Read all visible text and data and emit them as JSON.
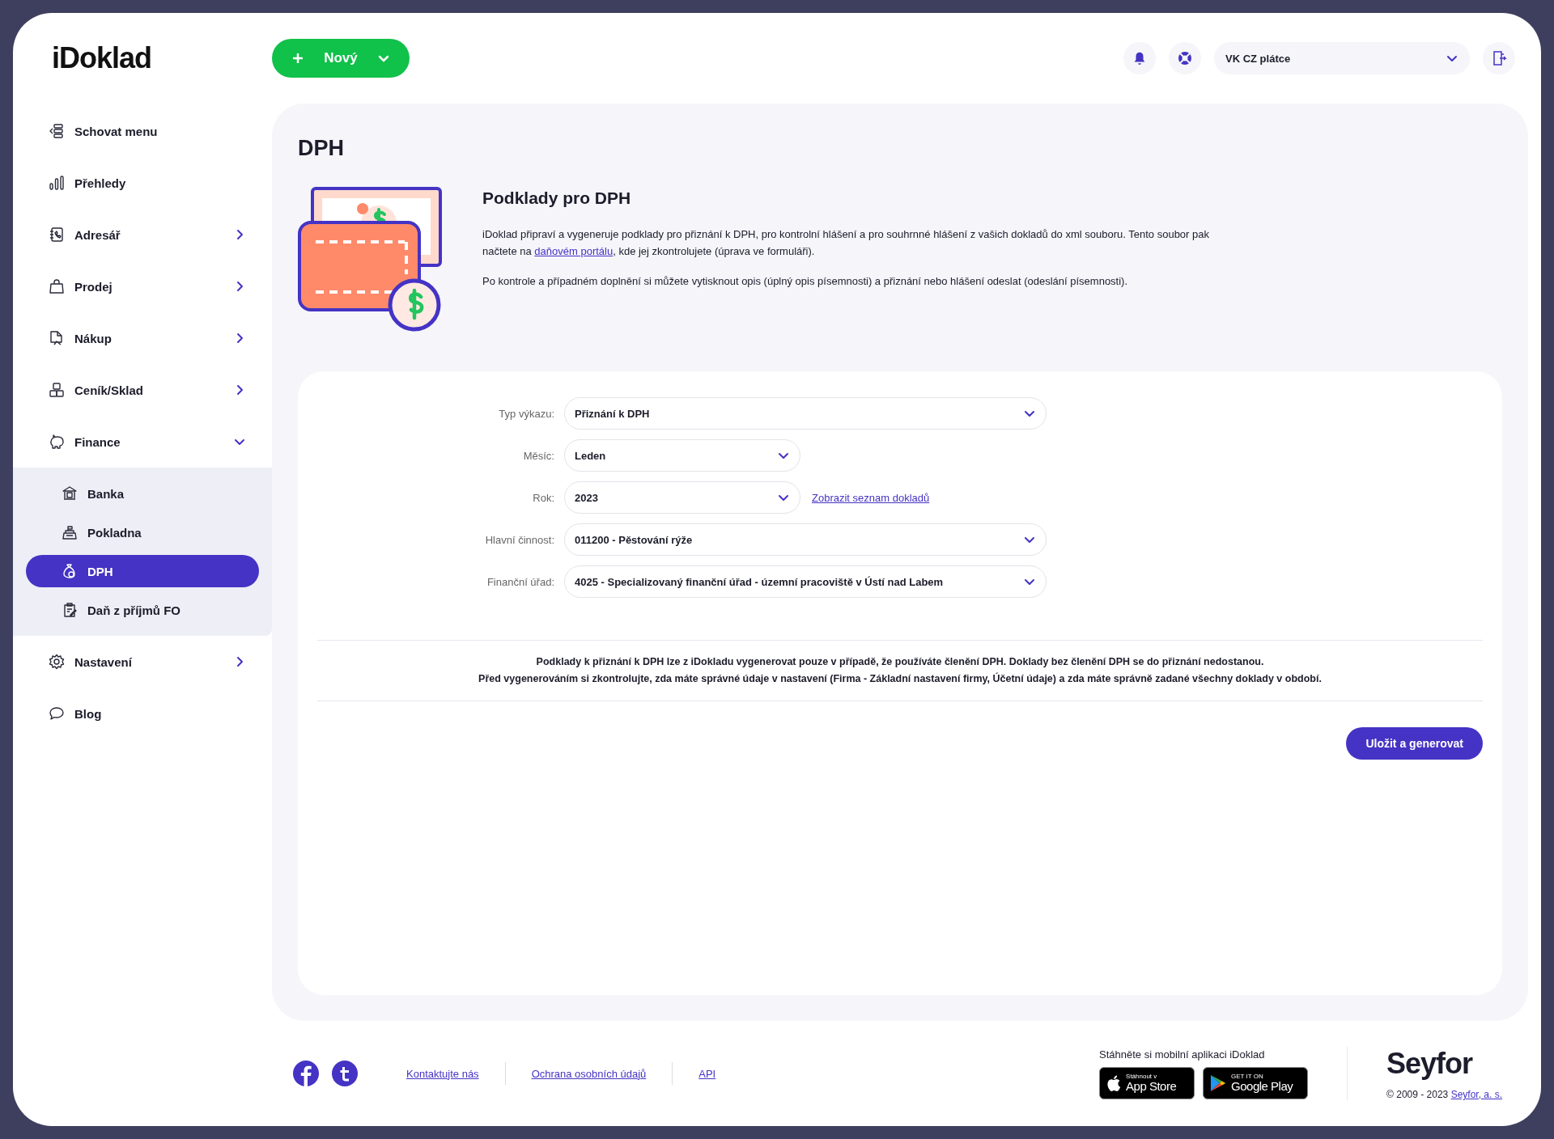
{
  "header": {
    "logo": "iDoklad",
    "new_button": "Nový",
    "company": "VK CZ plátce"
  },
  "sidebar": {
    "items": [
      {
        "label": "Schovat menu",
        "kind": "link",
        "selected": false
      },
      {
        "label": "Přehledy",
        "kind": "link",
        "selected": false
      },
      {
        "label": "Adresář",
        "kind": "submenu",
        "expanded": false,
        "selected": false
      },
      {
        "label": "Prodej",
        "kind": "submenu",
        "expanded": false,
        "selected": false
      },
      {
        "label": "Nákup",
        "kind": "submenu",
        "expanded": false,
        "selected": false
      },
      {
        "label": "Ceník/Sklad",
        "kind": "submenu",
        "expanded": false,
        "selected": false
      },
      {
        "label": "Finance",
        "kind": "submenu",
        "expanded": true,
        "selected": false,
        "children": [
          {
            "label": "Banka",
            "selected": false
          },
          {
            "label": "Pokladna",
            "selected": false
          },
          {
            "label": "DPH",
            "selected": true
          },
          {
            "label": "Daň z příjmů FO",
            "selected": false
          }
        ]
      },
      {
        "label": "Nastavení",
        "kind": "submenu",
        "expanded": false,
        "selected": false
      },
      {
        "label": "Blog",
        "kind": "link",
        "selected": false
      }
    ]
  },
  "page": {
    "title": "DPH",
    "intro": {
      "heading": "Podklady pro DPH",
      "paragraph_1": {
        "before": "iDoklad připraví a vygeneruje podklady pro přiznání k DPH, pro kontrolní hlášení a pro souhrnné hlášení z vašich dokladů do xml souboru. Tento soubor pak načtete na",
        "link": "daňovém portálu",
        "after": ", kde jej zkontrolujete (úprava ve formuláři)."
      },
      "paragraph_2": "Po kontrole a případném doplnění si můžete vytisknout opis (úplný opis písemnosti) a přiznání nebo hlášení odeslat (odeslání písemnosti)."
    },
    "form": {
      "fields": [
        {
          "label": "Typ výkazu:",
          "value": "Přiznání k DPH",
          "kind": "wide"
        },
        {
          "label": "Měsíc:",
          "value": "Leden",
          "kind": "narrow"
        },
        {
          "label": "Rok:",
          "value": "2023",
          "kind": "narrow",
          "link": "Zobrazit seznam dokladů"
        },
        {
          "label": "Hlavní činnost:",
          "value": "011200 - Pěstování rýže",
          "kind": "wide"
        },
        {
          "label": "Finanční úřad:",
          "value": "4025 - Specializovaný finanční úřad - územní pracoviště v Ústí nad Labem",
          "kind": "wide"
        }
      ],
      "notice": [
        "Podklady k přiznání k DPH lze z iDokladu vygenerovat pouze v případě, že používáte členění DPH. Doklady bez členění DPH se do přiznání nedostanou.",
        "Před vygenerováním si zkontrolujte, zda máte správné údaje v nastavení (Firma - Základní nastavení firmy, Účetní údaje) a zda máte správně zadané všechny doklady v období."
      ],
      "submit_button": "Uložit a generovat"
    }
  },
  "footer": {
    "links": [
      "Kontaktujte nás",
      "Ochrana osobních údajů",
      "API"
    ],
    "app_promo": "Stáhněte si mobilní aplikaci iDoklad",
    "app_store": {
      "small": "Stáhnout v",
      "large": "App Store"
    },
    "google_play": {
      "small": "GET IT ON",
      "large": "Google Play"
    },
    "brand": "Seyfor",
    "copyright": "© 2009 - 2023",
    "copyright_link": "Seyfor, a. s."
  }
}
